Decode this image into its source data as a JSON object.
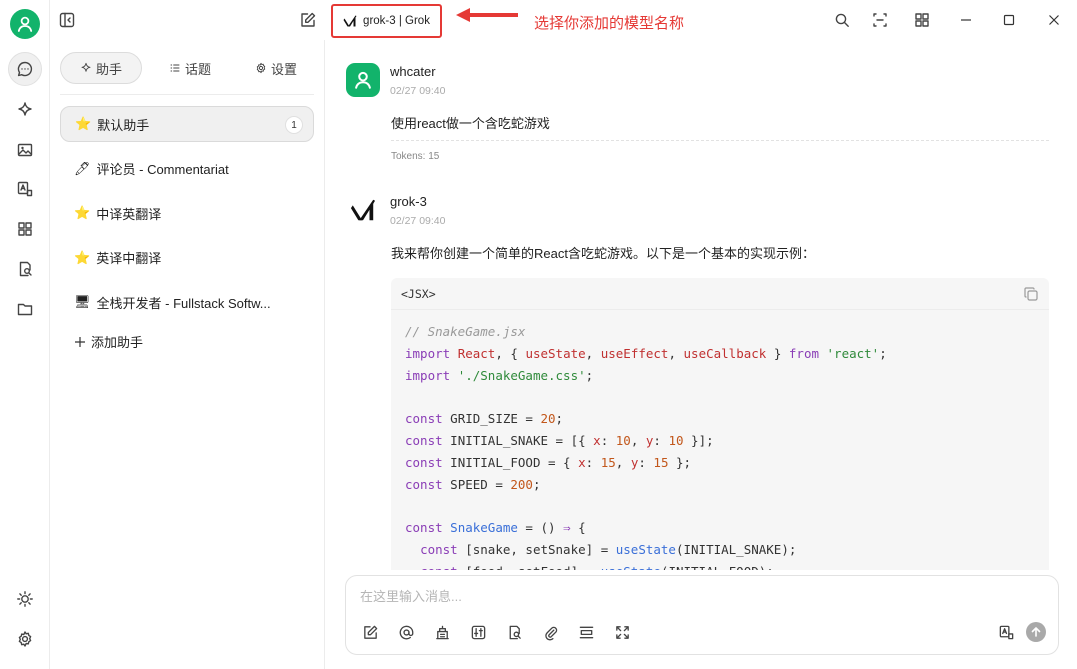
{
  "topbar": {
    "model_label": "grok-3 | Grok",
    "annotation": "选择你添加的模型名称"
  },
  "panel": {
    "tabs": [
      {
        "label": "助手",
        "icon": "sparkle-icon"
      },
      {
        "label": "话题",
        "icon": "list-icon"
      },
      {
        "label": "设置",
        "icon": "gear-icon"
      }
    ],
    "assistants": [
      {
        "emoji": "⭐",
        "label": "默认助手",
        "badge": "1"
      },
      {
        "emoji": "🖊",
        "label": "评论员 - Commentariat"
      },
      {
        "emoji": "⭐",
        "label": "中译英翻译"
      },
      {
        "emoji": "⭐",
        "label": "英译中翻译"
      },
      {
        "emoji": "🖥",
        "label": "全栈开发者 - Fullstack Softw..."
      }
    ],
    "add_label": "添加助手"
  },
  "chat": {
    "user": {
      "name": "whcater",
      "time": "02/27 09:40",
      "text": "使用react做一个含吃蛇游戏",
      "tokens": "Tokens: 15"
    },
    "bot": {
      "name": "grok-3",
      "time": "02/27 09:40",
      "text": "我来帮你创建一个简单的React含吃蛇游戏。以下是一个基本的实现示例：",
      "code_lang": "<JSX>"
    }
  },
  "input": {
    "placeholder": "在这里输入消息..."
  },
  "colors": {
    "accent": "#12b36b",
    "annotation": "#e53935"
  }
}
